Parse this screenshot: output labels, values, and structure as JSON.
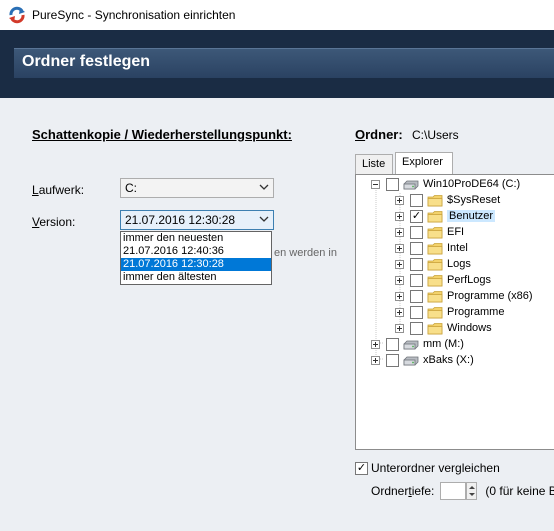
{
  "window": {
    "title": "PureSync - Synchronisation einrichten"
  },
  "header": {
    "title": "Ordner festlegen"
  },
  "shadow_copy": {
    "title": "Schattenkopie / Wiederherstellungspunkt:",
    "drive_label_accel": "L",
    "drive_label_rest": "aufwerk:",
    "drive_value": "C:",
    "version_label_accel": "V",
    "version_label_rest": "ersion:",
    "version_value": "21.07.2016 12:30:28",
    "version_options": [
      "immer den neuesten",
      "21.07.2016 12:40:36",
      "21.07.2016 12:30:28",
      "immer den ältesten"
    ],
    "selected_option_index": 2,
    "partial_hint": "en werden in"
  },
  "folder": {
    "label_accel": "O",
    "label_rest": "rdner:",
    "value": "C:\\Users",
    "tabs": [
      "Liste",
      "Explorer"
    ],
    "active_tab": "Explorer",
    "tree": [
      {
        "label": "Win10ProDE64 (C:)",
        "icon": "drive-icon",
        "checked": false,
        "expander": "minus",
        "level": 0
      },
      {
        "label": "$SysReset",
        "icon": "folder-icon",
        "checked": false,
        "expander": "plus",
        "level": 1
      },
      {
        "label": "Benutzer",
        "icon": "folder-icon",
        "checked": true,
        "expander": "plus",
        "level": 1
      },
      {
        "label": "EFI",
        "icon": "folder-icon",
        "checked": false,
        "expander": "plus",
        "level": 1
      },
      {
        "label": "Intel",
        "icon": "folder-icon",
        "checked": false,
        "expander": "plus",
        "level": 1
      },
      {
        "label": "Logs",
        "icon": "folder-icon",
        "checked": false,
        "expander": "plus",
        "level": 1
      },
      {
        "label": "PerfLogs",
        "icon": "folder-icon",
        "checked": false,
        "expander": "plus",
        "level": 1
      },
      {
        "label": "Programme (x86)",
        "icon": "folder-icon",
        "checked": false,
        "expander": "plus",
        "level": 1
      },
      {
        "label": "Programme",
        "icon": "folder-icon",
        "checked": false,
        "expander": "plus",
        "level": 1
      },
      {
        "label": "Windows",
        "icon": "folder-icon",
        "checked": false,
        "expander": "plus",
        "level": 1
      },
      {
        "label": "mm (M:)",
        "icon": "drive-icon",
        "checked": false,
        "expander": "plus",
        "level": 0
      },
      {
        "label": "xBaks (X:)",
        "icon": "drive-icon",
        "checked": false,
        "expander": "plus",
        "level": 0
      }
    ],
    "subfolders_label": "Unterordner vergleichen",
    "subfolders_checked": true,
    "depth_label_pre": "Ordner",
    "depth_label_accel": "t",
    "depth_label_post": "iefe:",
    "depth_hint": "(0 für keine B"
  },
  "colors": {
    "header_dark": "#1a2c44",
    "header_band": "#3d5878",
    "selection": "#0078d7",
    "folder_yellow": "#f3d26b"
  }
}
